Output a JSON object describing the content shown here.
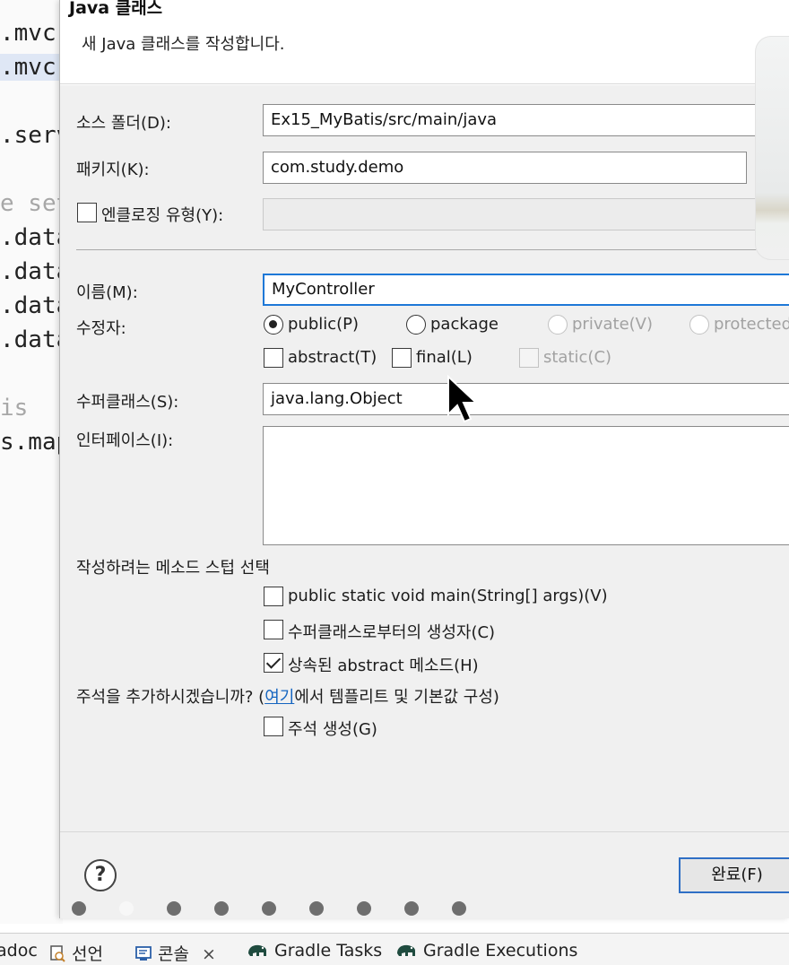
{
  "editor": {
    "lines": [
      ".mvc",
      ".mvc",
      ".serv",
      "e set",
      ".data",
      ".data",
      ".data",
      ".data",
      "is",
      "s.map"
    ]
  },
  "dialog": {
    "title": "Java 클래스",
    "subtitle": "새 Java 클래스를 작성합니다.",
    "source_folder": {
      "label": "소스 폴더(D):",
      "value": "Ex15_MyBatis/src/main/java"
    },
    "package": {
      "label": "패키지(K):",
      "value": "com.study.demo"
    },
    "enclosing": {
      "label": "엔클로징 유형(Y):",
      "value": ""
    },
    "name": {
      "label": "이름(M):",
      "value": "MyController"
    },
    "modifiers": {
      "label": "수정자:",
      "public": "public(P)",
      "package": "package",
      "private": "private(V)",
      "protected": "protected",
      "abstract": "abstract(T)",
      "final": "final(L)",
      "static": "static(C)"
    },
    "superclass": {
      "label": "수퍼클래스(S):",
      "value": "java.lang.Object"
    },
    "interfaces": {
      "label": "인터페이스(I):"
    },
    "stubs": {
      "label": "작성하려는 메소드 스텁 선택",
      "main": "public static void main(String[] args)(V)",
      "constructors": "수퍼클래스로부터의 생성자(C)",
      "inherited": "상속된 abstract 메소드(H)"
    },
    "comments": {
      "prefix": "주석을 추가하시겠습니까? (",
      "link": "여기",
      "suffix": "에서 템플리트 및 기본값 구성)",
      "generate": "주석 생성(G)"
    },
    "footer": {
      "help": "?",
      "finish": "완료(F)"
    }
  },
  "tabbar": {
    "javadoc": "adoc",
    "declaration": "선언",
    "console": "콘솔",
    "close": "×",
    "gradle_tasks": "Gradle Tasks",
    "gradle_executions": "Gradle Executions"
  }
}
